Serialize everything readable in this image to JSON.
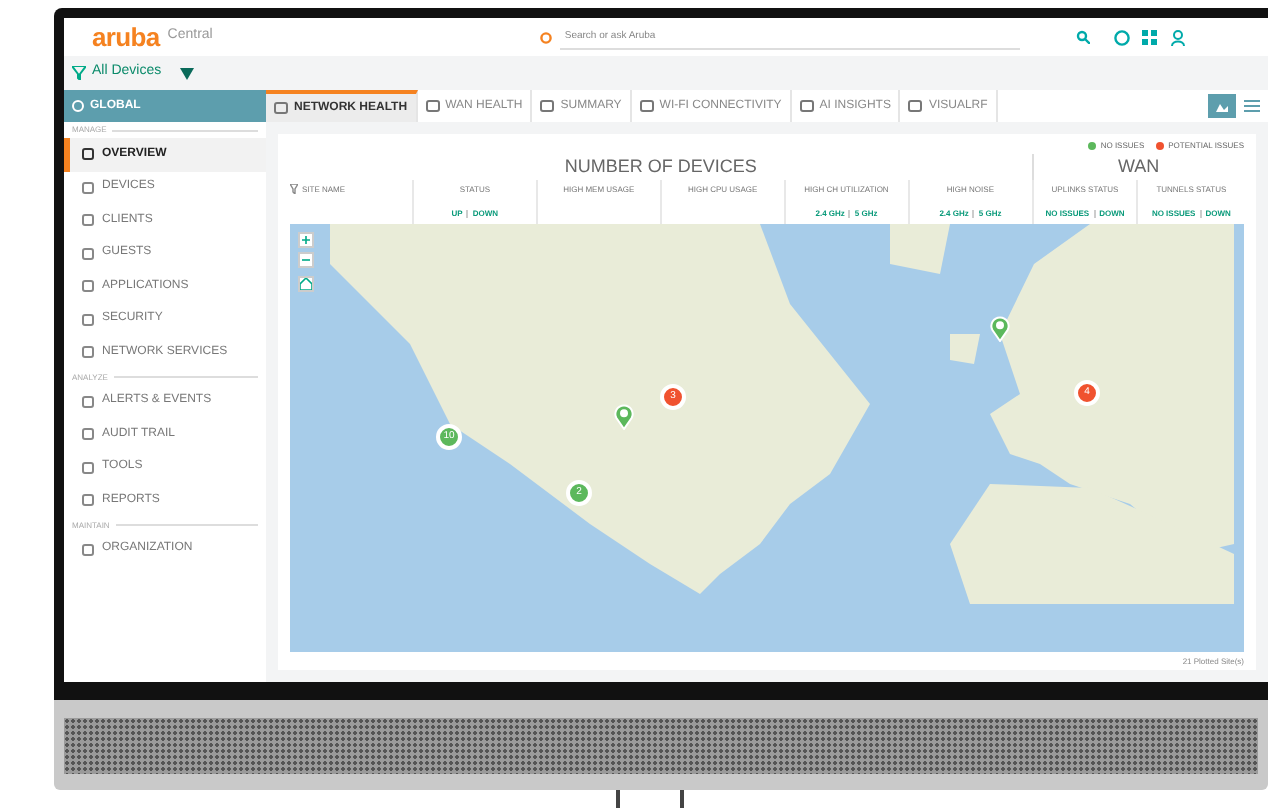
{
  "header": {
    "logo": "aruba",
    "product": "Central",
    "search": {
      "placeholder": "Search or ask Aruba"
    }
  },
  "filter": {
    "label": "All Devices"
  },
  "sidebar": {
    "scope": "GLOBAL",
    "items": [
      {
        "kind": "section",
        "label": "MANAGE"
      },
      {
        "kind": "item",
        "label": "OVERVIEW",
        "selected": true
      },
      {
        "kind": "item",
        "label": "DEVICES",
        "selected": false
      },
      {
        "kind": "item",
        "label": "CLIENTS",
        "selected": false
      },
      {
        "kind": "item",
        "label": "GUESTS",
        "selected": false
      },
      {
        "kind": "item",
        "label": "APPLICATIONS",
        "selected": false
      },
      {
        "kind": "item",
        "label": "SECURITY",
        "selected": false
      },
      {
        "kind": "item",
        "label": "NETWORK SERVICES",
        "selected": false
      },
      {
        "kind": "section",
        "label": "ANALYZE"
      },
      {
        "kind": "item",
        "label": "ALERTS & EVENTS",
        "selected": false
      },
      {
        "kind": "item",
        "label": "AUDIT TRAIL",
        "selected": false
      },
      {
        "kind": "item",
        "label": "TOOLS",
        "selected": false
      },
      {
        "kind": "item",
        "label": "REPORTS",
        "selected": false
      },
      {
        "kind": "section",
        "label": "MAINTAIN"
      },
      {
        "kind": "item",
        "label": "ORGANIZATION",
        "selected": false
      }
    ]
  },
  "tabs": [
    {
      "label": "NETWORK HEALTH",
      "selected": true
    },
    {
      "label": "WAN HEALTH",
      "selected": false
    },
    {
      "label": "SUMMARY",
      "selected": false
    },
    {
      "label": "WI-FI CONNECTIVITY",
      "selected": false
    },
    {
      "label": "AI INSIGHTS",
      "selected": false
    },
    {
      "label": "VISUALRF",
      "selected": false
    }
  ],
  "legend": [
    {
      "label": "NO ISSUES",
      "color": "#5cb85c"
    },
    {
      "label": "POTENTIAL ISSUES",
      "color": "#f0522f"
    }
  ],
  "groups": [
    {
      "label": "NUMBER OF DEVICES",
      "columns": [
        {
          "label": "SITE NAME"
        },
        {
          "label": "STATUS",
          "links": [
            "UP",
            "DOWN"
          ]
        },
        {
          "label": "HIGH MEM USAGE"
        },
        {
          "label": "HIGH CPU USAGE"
        },
        {
          "label": "HIGH CH UTILIZATION",
          "links": [
            "2.4 GHz",
            "5 GHz"
          ]
        },
        {
          "label": "HIGH NOISE",
          "links": [
            "2.4 GHz",
            "5 GHz"
          ]
        }
      ]
    },
    {
      "label": "WAN",
      "columns": [
        {
          "label": "UPLINKS STATUS",
          "links": [
            "NO ISSUES",
            "DOWN"
          ]
        },
        {
          "label": "TUNNELS STATUS",
          "links": [
            "NO ISSUES",
            "DOWN"
          ]
        }
      ]
    }
  ],
  "map": {
    "markers": [
      {
        "kind": "cluster",
        "count": "10",
        "color": "#5cb85c"
      },
      {
        "kind": "cluster",
        "count": "2",
        "color": "#5cb85c"
      },
      {
        "kind": "pin",
        "color": "#5cb85c"
      },
      {
        "kind": "cluster",
        "count": "3",
        "color": "#f0522f"
      },
      {
        "kind": "pin",
        "color": "#5cb85c"
      },
      {
        "kind": "cluster",
        "count": "4",
        "color": "#f0522f"
      }
    ]
  },
  "footer": "21 Plotted Site(s)"
}
